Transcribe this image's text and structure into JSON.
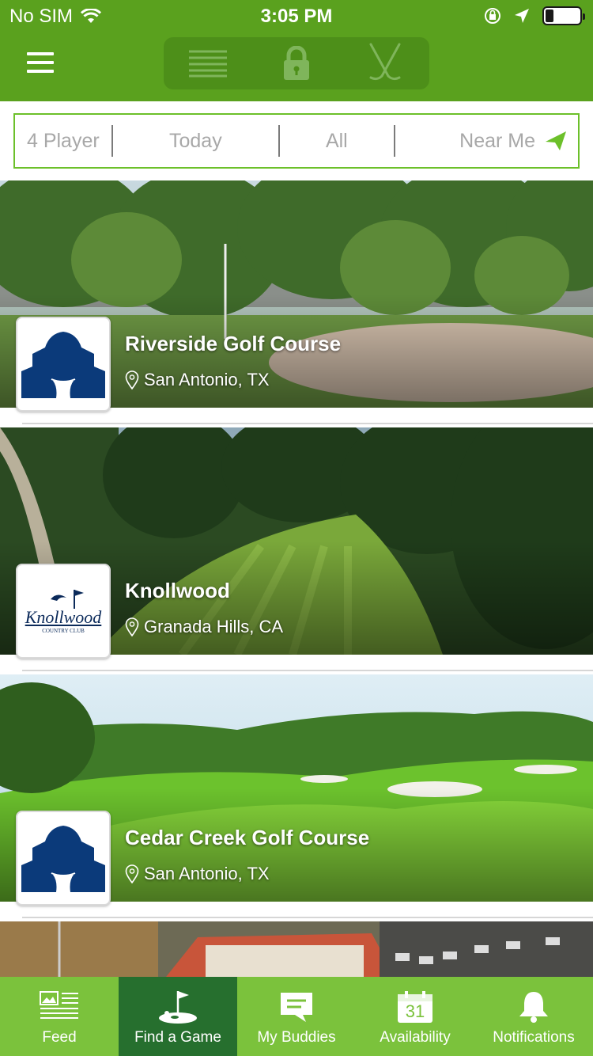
{
  "status_bar": {
    "carrier": "No SIM",
    "time": "3:05 PM"
  },
  "header": {
    "menu_icon": "hamburger-menu-icon",
    "segments": [
      {
        "icon": "list-lines-icon"
      },
      {
        "icon": "lock-icon"
      },
      {
        "icon": "golf-clubs-icon"
      }
    ]
  },
  "filters": {
    "players": "4 Player",
    "day": "Today",
    "type": "All",
    "location": "Near Me"
  },
  "courses": [
    {
      "name": "Riverside Golf Course",
      "location": "San Antonio, TX",
      "logo": "alamo-tee-logo"
    },
    {
      "name": "Knollwood",
      "location": "Granada Hills, CA",
      "logo": "knollwood-logo",
      "logo_text": "Knollwood",
      "logo_subtext": "COUNTRY CLUB"
    },
    {
      "name": "Cedar Creek Golf Course",
      "location": "San Antonio, TX",
      "logo": "alamo-tee-logo"
    }
  ],
  "tabs": [
    {
      "label": "Feed",
      "icon": "newspaper-icon",
      "active": false
    },
    {
      "label": "Find a Game",
      "icon": "golf-flag-icon",
      "active": true
    },
    {
      "label": "My Buddies",
      "icon": "chat-bubble-icon",
      "active": false
    },
    {
      "label": "Availability",
      "icon": "calendar-icon",
      "active": false,
      "calendar_day": "31"
    },
    {
      "label": "Notifications",
      "icon": "bell-icon",
      "active": false
    }
  ],
  "colors": {
    "brand_green": "#5aa11e",
    "tab_green": "#7bc23c",
    "tab_active": "#266f2e",
    "logo_blue": "#0b3a7a"
  }
}
